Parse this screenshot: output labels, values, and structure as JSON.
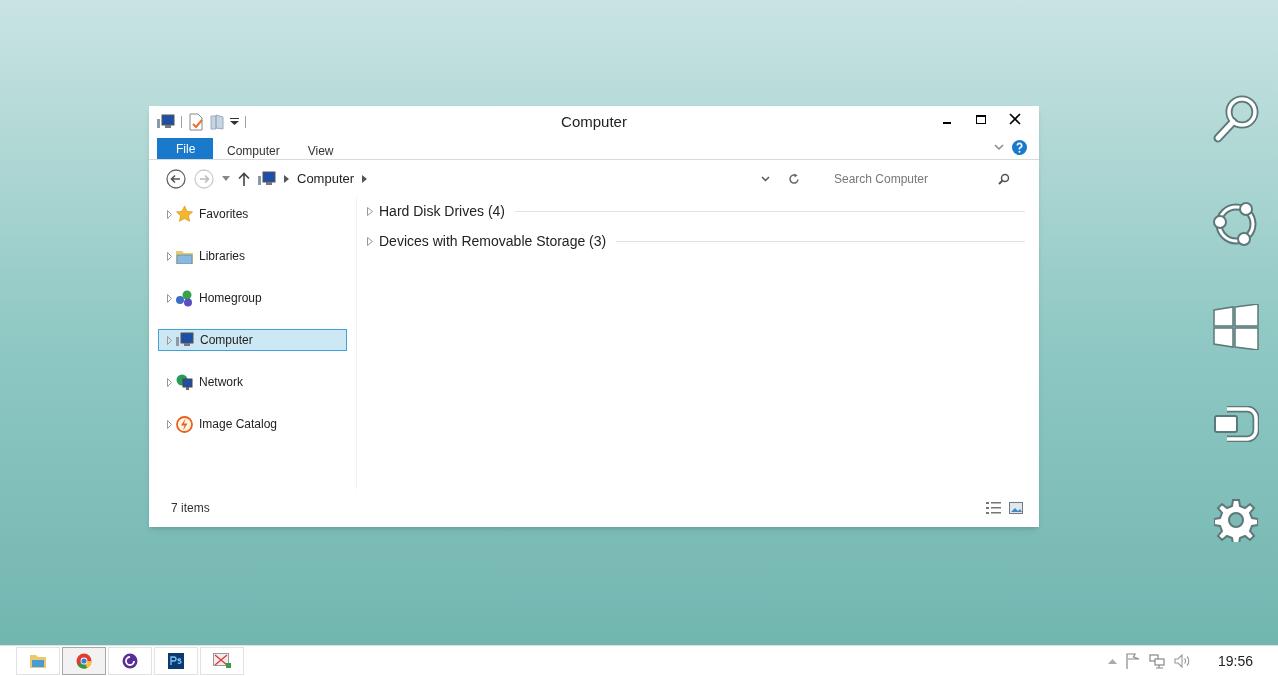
{
  "window": {
    "title": "Computer"
  },
  "ribbon_tabs": [
    {
      "label": "File",
      "selected": true
    },
    {
      "label": "Computer",
      "selected": false
    },
    {
      "label": "View",
      "selected": false
    }
  ],
  "address_bar": {
    "breadcrumb": "Computer"
  },
  "search": {
    "placeholder": "Search Computer"
  },
  "navigation": [
    {
      "label": "Favorites",
      "selected": false
    },
    {
      "label": "Libraries",
      "selected": false
    },
    {
      "label": "Homegroup",
      "selected": false
    },
    {
      "label": "Computer",
      "selected": true
    },
    {
      "label": "Network",
      "selected": false
    },
    {
      "label": "Image Catalog",
      "selected": false
    }
  ],
  "groups": [
    {
      "label": "Hard Disk Drives (4)",
      "expanded": false
    },
    {
      "label": "Devices with Removable Storage (3)",
      "expanded": false
    }
  ],
  "status_bar": {
    "item_count": "7 items"
  },
  "taskbar": {
    "apps": [
      {
        "selected": false
      },
      {
        "selected": true
      },
      {
        "selected": false
      },
      {
        "selected": false
      },
      {
        "selected": false
      }
    ],
    "clock": "19:56"
  }
}
